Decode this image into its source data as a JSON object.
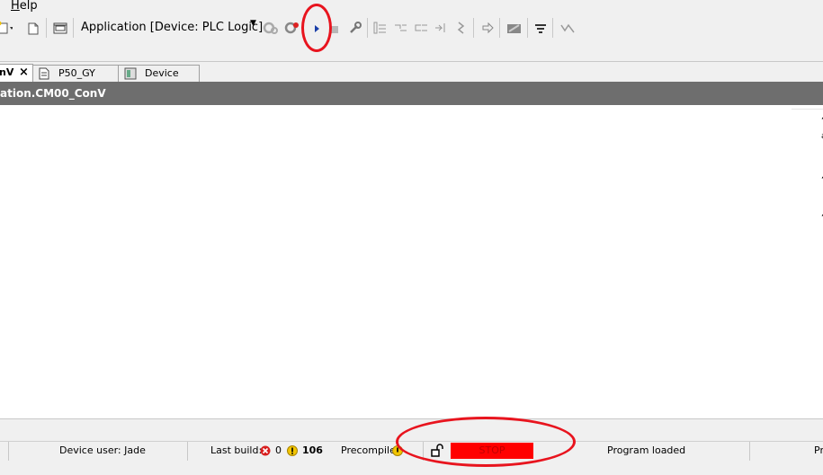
{
  "menu": {
    "help_prefix": "",
    "help_underlined": "H",
    "help_rest": "elp"
  },
  "toolbar": {
    "application_combo": "Application [Device: PLC Logic]",
    "icons": [
      "new-file-icon",
      "open-icon",
      "device-config-icon",
      "build-icon",
      "rebuild-icon",
      "start-icon",
      "stop-icon",
      "reset-icon",
      "step-over-icon",
      "step-into-icon",
      "step-out-icon",
      "run-to-cursor-icon",
      "breakpoint-icon",
      "next-statement-icon",
      "force-icon",
      "write-values-icon",
      "debug-icon"
    ]
  },
  "tabs": [
    {
      "label": "nV",
      "active": true,
      "close": "×"
    },
    {
      "label": "P50_GY",
      "active": false
    },
    {
      "label": "Device",
      "active": false
    }
  ],
  "editor": {
    "title": "ation.CM00_ConV",
    "right_fragments": [
      ",",
      "a",
      ",",
      ","
    ]
  },
  "status": {
    "device_user_label": "Device user: Jade",
    "last_build_label": "Last build:",
    "errors": "0",
    "warnings": "106",
    "precompile_label": "Precompile",
    "plc_state": "STOP",
    "program_state": "Program loaded",
    "trailing": "Pr"
  },
  "colors": {
    "stop_bg": "#ff0000",
    "titlebar_bg": "#6e6e6e",
    "annotation": "#e8141e"
  }
}
